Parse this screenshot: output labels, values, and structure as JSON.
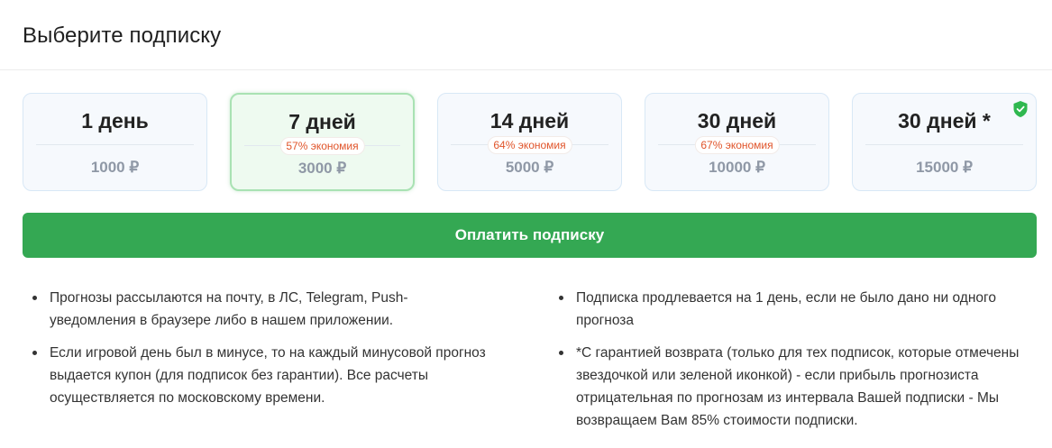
{
  "header": {
    "title": "Выберите подписку"
  },
  "plans": [
    {
      "title": "1 день",
      "badge": "",
      "price": "1000 ₽",
      "selected": false
    },
    {
      "title": "7 дней",
      "badge": "57% экономия",
      "price": "3000 ₽",
      "selected": true
    },
    {
      "title": "14 дней",
      "badge": "64% экономия",
      "price": "5000 ₽",
      "selected": false
    },
    {
      "title": "30 дней",
      "badge": "67% экономия",
      "price": "10000 ₽",
      "selected": false
    },
    {
      "title": "30 дней *",
      "badge": "",
      "price": "15000 ₽",
      "selected": false,
      "icon": "shield-check-icon"
    }
  ],
  "pay_button": {
    "label": "Оплатить подписку"
  },
  "notes_left": [
    "Прогнозы рассылаются на почту, в ЛС, Telegram, Push-уведомления в браузере либо в нашем приложении.",
    "Если игровой день был в минусе, то на каждый минусовой прогноз выдается купон (для подписок без гарантии). Все расчеты осуществляется по московскому времени."
  ],
  "notes_right": [
    "Подписка продлевается на 1 день, если не было дано ни одного прогноза",
    "*С гарантией возврата (только для тех подписок, которые отмечены звездочкой или зеленой иконкой) - если прибыль прогнозиста отрицательная по прогнозам из интервала Вашей подписки - Мы возвращаем Вам 85% стоимости подписки."
  ],
  "colors": {
    "accent_green": "#34a853",
    "badge_text": "#e0542a",
    "price_text": "#8f98a6",
    "shield": "#2fb84f"
  }
}
